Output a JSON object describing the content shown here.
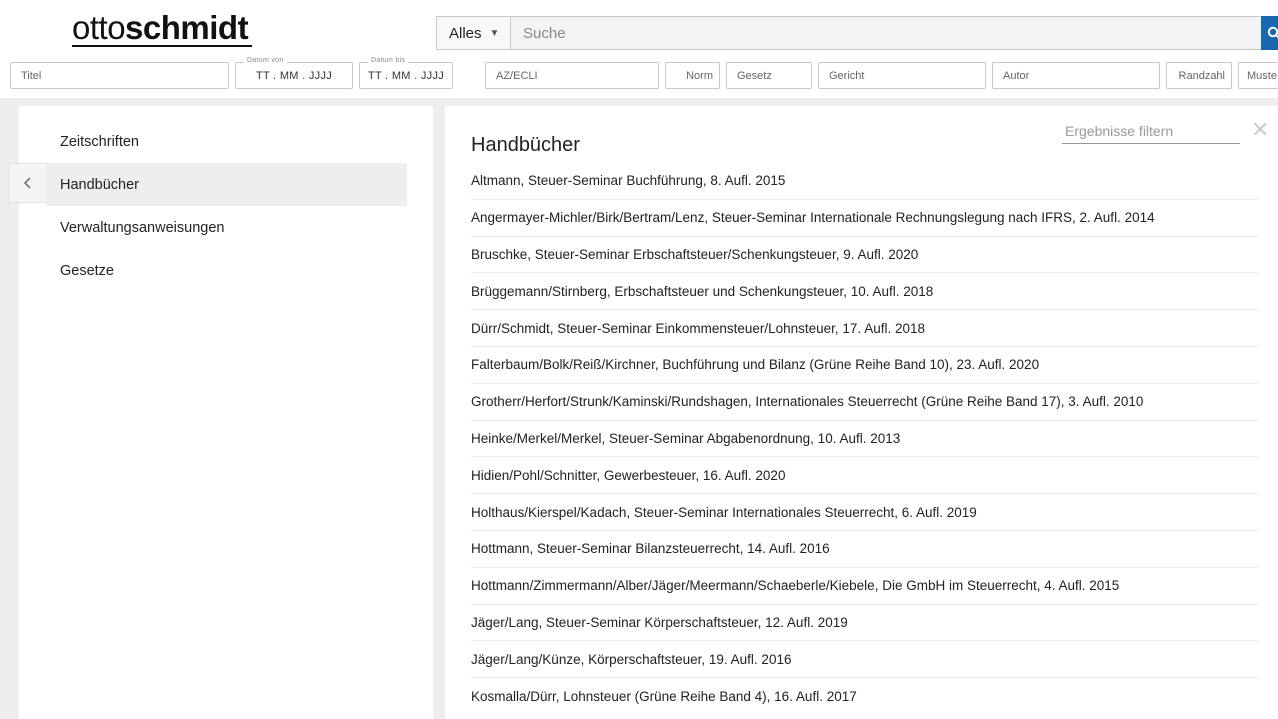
{
  "header": {
    "logo_light": "otto",
    "logo_bold": "schmidt"
  },
  "search": {
    "scope_label": "Alles",
    "placeholder": "Suche",
    "value": ""
  },
  "filters": {
    "titel": "Titel",
    "datum_von_label": "Datum von",
    "datum_von_value": "TT . MM . JJJJ",
    "datum_bis_label": "Datum bis",
    "datum_bis_value": "TT . MM . JJJJ",
    "az_ecli": "AZ/ECLI",
    "norm": "Norm",
    "gesetz": "Gesetz",
    "gericht": "Gericht",
    "autor": "Autor",
    "randzahl": "Randzahl",
    "muster": "Muste"
  },
  "sidebar": {
    "items": [
      {
        "label": "Zeitschriften"
      },
      {
        "label": "Handbücher"
      },
      {
        "label": "Verwaltungsanweisungen"
      },
      {
        "label": "Gesetze"
      }
    ]
  },
  "main": {
    "title": "Handbücher",
    "filter_placeholder": "Ergebnisse filtern",
    "results": [
      "Altmann, Steuer-Seminar Buchführung, 8. Aufl. 2015",
      "Angermayer-Michler/Birk/Bertram/Lenz, Steuer-Seminar Internationale Rechnungslegung nach IFRS, 2. Aufl. 2014",
      "Bruschke, Steuer-Seminar Erbschaftsteuer/Schenkungsteuer, 9. Aufl. 2020",
      "Brüggemann/Stirnberg, Erbschaftsteuer und Schenkungsteuer, 10. Aufl. 2018",
      "Dürr/Schmidt, Steuer-Seminar Einkommensteuer/Lohnsteuer, 17. Aufl. 2018",
      "Falterbaum/Bolk/Reiß/Kirchner, Buchführung und Bilanz (Grüne Reihe Band 10), 23. Aufl. 2020",
      "Grotherr/Herfort/Strunk/Kaminski/Rundshagen, Internationales Steuerrecht (Grüne Reihe Band 17), 3. Aufl. 2010",
      "Heinke/Merkel/Merkel, Steuer-Seminar Abgabenordnung, 10. Aufl. 2013",
      "Hidien/Pohl/Schnitter, Gewerbesteuer, 16. Aufl. 2020",
      "Holthaus/Kierspel/Kadach, Steuer-Seminar Internationales Steuerrecht, 6. Aufl. 2019",
      "Hottmann, Steuer-Seminar Bilanzsteuerrecht, 14. Aufl. 2016",
      "Hottmann/Zimmermann/Alber/Jäger/Meermann/Schaeberle/Kiebele, Die GmbH im Steuerrecht, 4. Aufl. 2015",
      "Jäger/Lang, Steuer-Seminar Körperschaftsteuer, 12. Aufl. 2019",
      "Jäger/Lang/Künze, Körperschaftsteuer, 19. Aufl. 2016",
      "Kosmalla/Dürr, Lohnsteuer (Grüne Reihe Band 4), 16. Aufl. 2017"
    ]
  },
  "colors": {
    "accent": "#1a66b0",
    "active_bg": "#eeeeee",
    "page_bg": "#eeeeee"
  },
  "icons": {
    "dropdown": "caret-down-icon",
    "search": "search-icon",
    "collapse": "chevron-left-icon",
    "clear": "close-icon"
  }
}
